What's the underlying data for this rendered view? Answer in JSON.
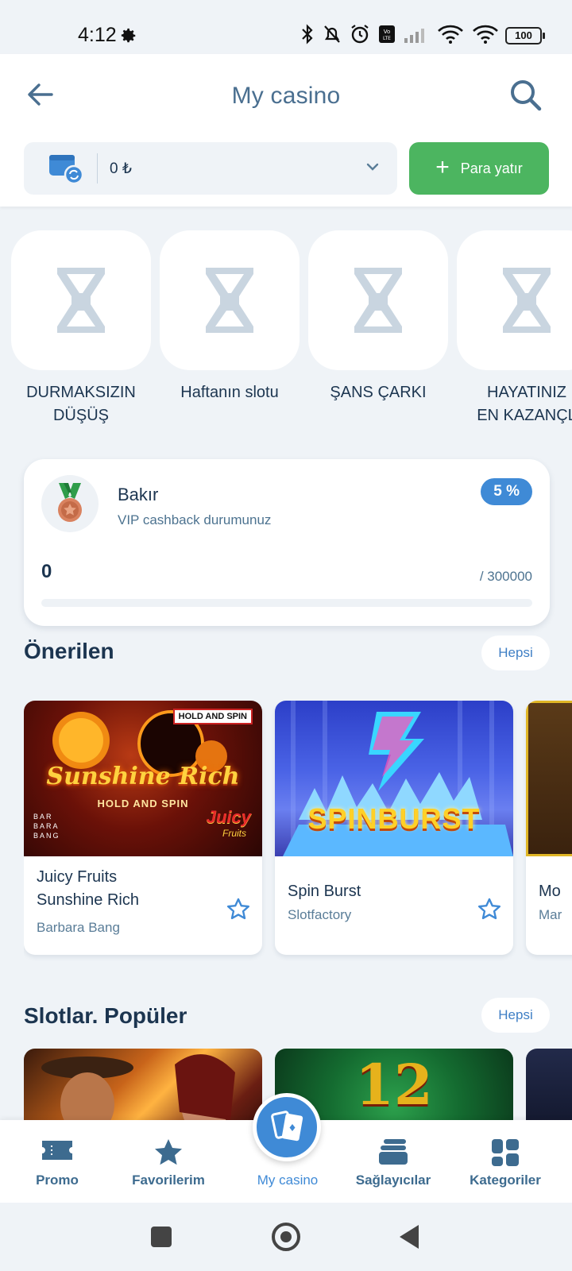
{
  "status_bar": {
    "time": "4:12",
    "battery": "100"
  },
  "header": {
    "title": "My casino"
  },
  "balance": {
    "value": "0 ₺",
    "deposit_label": "Para yatır"
  },
  "stories": [
    {
      "label_line1": "DURMAKSIZIN",
      "label_line2": "DÜŞÜŞ"
    },
    {
      "label_line1": "Haftanın slotu",
      "label_line2": ""
    },
    {
      "label_line1": "ŞANS ÇARKI",
      "label_line2": ""
    },
    {
      "label_line1": "HAYATINIZ",
      "label_line2": "EN KAZANÇL"
    }
  ],
  "vip": {
    "level": "Bakır",
    "subtitle": "VIP cashback durumunuz",
    "percent": "5 %",
    "points": "0",
    "target": "/ 300000",
    "progress_fraction": 0
  },
  "recommended": {
    "title": "Önerilen",
    "all_label": "Hepsi",
    "games": [
      {
        "name_line1": "Juicy Fruits",
        "name_line2": "Sunshine Rich",
        "provider": "Barbara Bang",
        "art_title": "Sunshine Rich",
        "art_badge": "HOLD AND SPIN",
        "art_sub": "HOLD AND SPIN",
        "art_brand": "Juicy",
        "art_brand2": "Fruits",
        "art_logo": "BAR BARA BANG"
      },
      {
        "name_line1": "Spin Burst",
        "name_line2": "",
        "provider": "Slotfactory",
        "art_title": "SPINBURST"
      },
      {
        "name_line1": "Mo",
        "name_line2": "",
        "provider": "Mar"
      }
    ]
  },
  "popular": {
    "title": "Slotlar. Popüler",
    "all_label": "Hepsi",
    "tile2_number": "12"
  },
  "bottom_nav": [
    {
      "label": "Promo",
      "icon": "ticket-icon"
    },
    {
      "label": "Favorilerim",
      "icon": "star-icon"
    },
    {
      "label": "My casino",
      "icon": "cards-icon"
    },
    {
      "label": "Sağlayıcılar",
      "icon": "stack-icon"
    },
    {
      "label": "Kategoriler",
      "icon": "grid-icon"
    }
  ],
  "colors": {
    "accent": "#3f8ad6",
    "deposit": "#4cb560",
    "text": "#1c3550",
    "muted": "#4d7390",
    "background": "#eff3f7"
  }
}
